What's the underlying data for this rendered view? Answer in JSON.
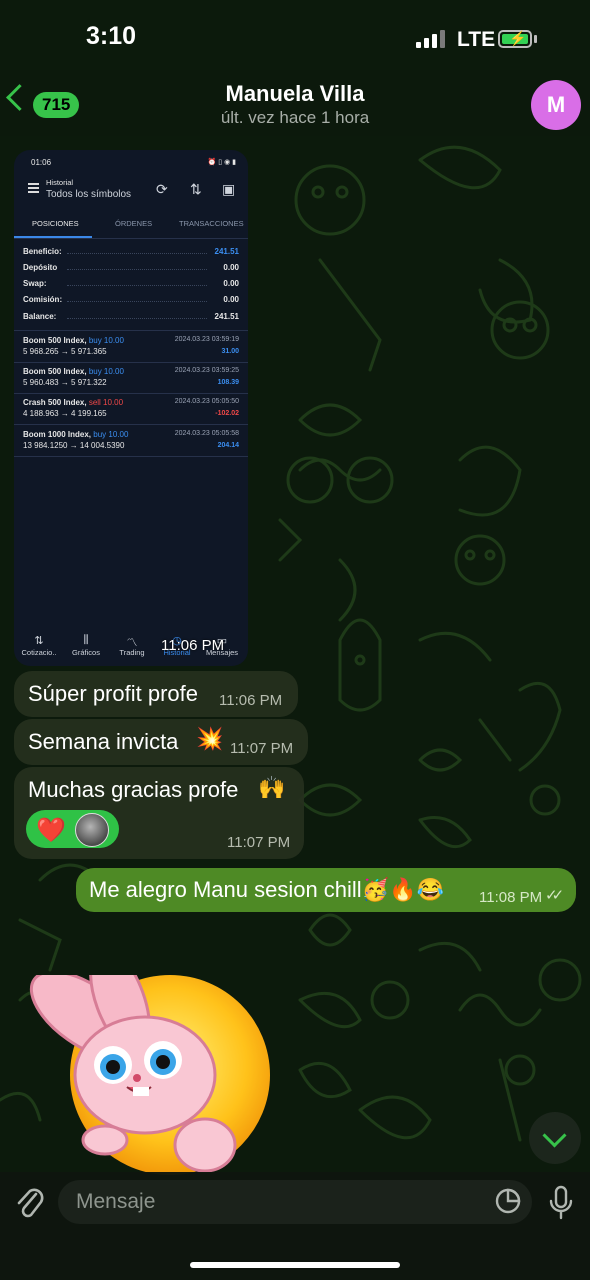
{
  "status_bar": {
    "time": "3:10",
    "network": "LTE"
  },
  "header": {
    "back_count": "715",
    "title": "Manuela Villa",
    "subtitle": "últ. vez hace 1 hora",
    "avatar_letter": "M",
    "avatar_color": "#d96ee7"
  },
  "screenshot": {
    "phone_time": "01:06",
    "status_icons": "⏰ ▯ ◉ ▮",
    "header_title": "Historial",
    "header_subtitle": "Todos los símbolos",
    "tabs": [
      "POSICIONES",
      "ÓRDENES",
      "TRANSACCIONES"
    ],
    "summary": [
      {
        "label": "Beneficio:",
        "value": "241.51",
        "color": "blue"
      },
      {
        "label": "Depósito",
        "value": "0.00",
        "color": "white"
      },
      {
        "label": "Swap:",
        "value": "0.00",
        "color": "white"
      },
      {
        "label": "Comisión:",
        "value": "0.00",
        "color": "white"
      },
      {
        "label": "Balance:",
        "value": "241.51",
        "color": "white"
      }
    ],
    "trades": [
      {
        "symbol": "Boom 500 Index,",
        "dir": "buy 10.00",
        "dir_type": "buy",
        "prices": "5 968.265 → 5 971.365",
        "date": "2024.03.23 03:59:19",
        "profit": "31.00",
        "profit_type": "pos"
      },
      {
        "symbol": "Boom 500 Index,",
        "dir": "buy 10.00",
        "dir_type": "buy",
        "prices": "5 960.483 → 5 971.322",
        "date": "2024.03.23 03:59:25",
        "profit": "108.39",
        "profit_type": "pos"
      },
      {
        "symbol": "Crash 500 Index,",
        "dir": "sell 10.00",
        "dir_type": "sell",
        "prices": "4 188.963 → 4 199.165",
        "date": "2024.03.23 05:05:50",
        "profit": "-102.02",
        "profit_type": "neg"
      },
      {
        "symbol": "Boom 1000 Index,",
        "dir": "buy 10.00",
        "dir_type": "buy",
        "prices": "13 984.1250 → 14 004.5390",
        "date": "2024.03.23 05:05:58",
        "profit": "204.14",
        "profit_type": "pos"
      }
    ],
    "bottom_nav": [
      {
        "label": "Cotizacio..",
        "icon": "⇅"
      },
      {
        "label": "Gráficos",
        "icon": "⫼"
      },
      {
        "label": "Trading",
        "icon": "〽"
      },
      {
        "label": "Historial",
        "icon": "◷"
      },
      {
        "label": "Mensajes",
        "icon": "▭"
      }
    ],
    "bubble_time": "11:06 PM"
  },
  "messages": [
    {
      "text": "Súper profit profe",
      "emoji": "",
      "time": "11:06 PM"
    },
    {
      "text": "Semana invicta",
      "emoji": "💥",
      "time": "11:07 PM"
    },
    {
      "text": "Muchas gracias profe",
      "emoji": "🙌",
      "time": "11:07 PM",
      "reaction": "❤️"
    }
  ],
  "outgoing": {
    "text": "Me alegro Manu sesion chill🥳🔥😂",
    "time": "11:08 PM",
    "checks": "✓✓"
  },
  "input": {
    "placeholder": "Mensaje"
  },
  "colors": {
    "accent": "#37c34a",
    "outgoing_bubble": "#4e8a25",
    "incoming_bubble": "#26301e",
    "profit_blue": "#3b8ef0",
    "loss_red": "#f04848"
  }
}
